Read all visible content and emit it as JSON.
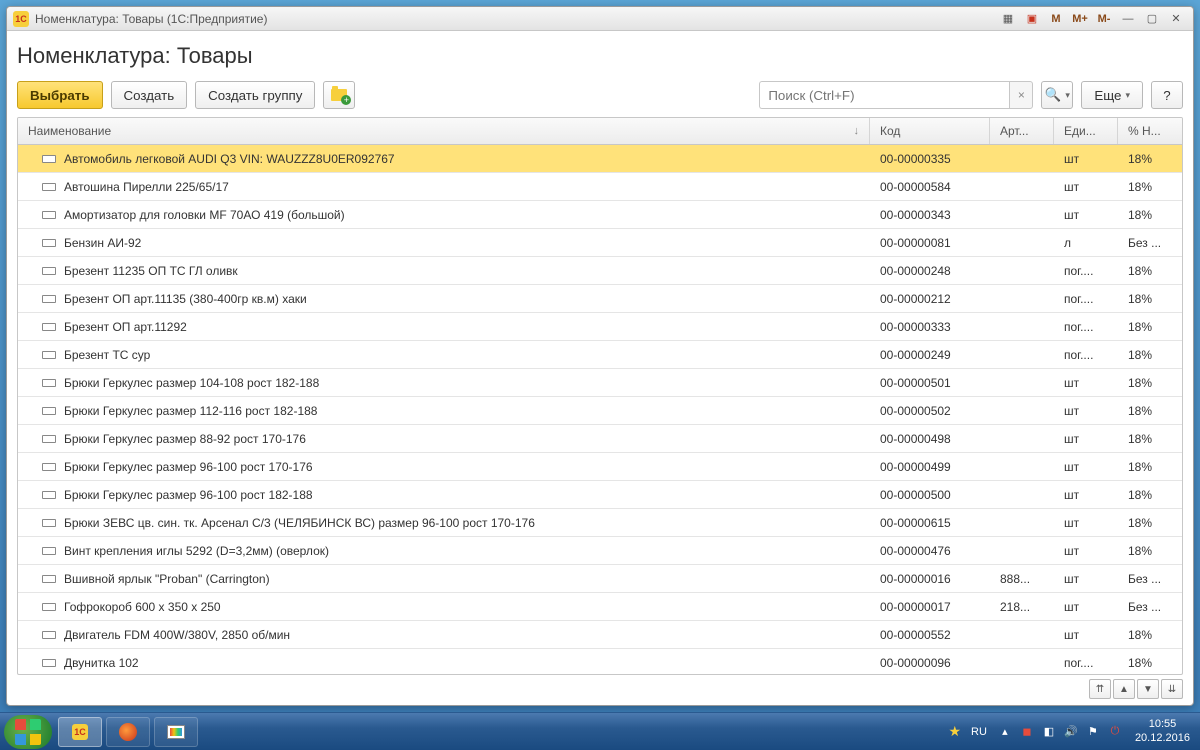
{
  "window": {
    "title": "Номенклатура: Товары (1С:Предприятие)",
    "mem_buttons": [
      "M",
      "M+",
      "M-"
    ]
  },
  "page": {
    "title": "Номенклатура: Товары"
  },
  "toolbar": {
    "select": "Выбрать",
    "create": "Создать",
    "create_group": "Создать группу",
    "more": "Еще",
    "help": "?"
  },
  "search": {
    "placeholder": "Поиск (Ctrl+F)",
    "clear": "×"
  },
  "columns": {
    "name": "Наименование",
    "sort": "↓",
    "code": "Код",
    "art": "Арт...",
    "unit": "Еди...",
    "vat": "% Н..."
  },
  "rows": [
    {
      "name": "Автомобиль легковой AUDI Q3 VIN: WAUZZZ8U0ER092767",
      "code": "00-00000335",
      "art": "",
      "unit": "шт",
      "vat": "18%",
      "sel": true
    },
    {
      "name": "Автошина Пирелли 225/65/17",
      "code": "00-00000584",
      "art": "",
      "unit": "шт",
      "vat": "18%"
    },
    {
      "name": "Амортизатор для головки MF 70АО 419 (большой)",
      "code": "00-00000343",
      "art": "",
      "unit": "шт",
      "vat": "18%"
    },
    {
      "name": "Бензин АИ-92",
      "code": "00-00000081",
      "art": "",
      "unit": "л",
      "vat": "Без ..."
    },
    {
      "name": "Брезент 11235 ОП ТС ГЛ оливк",
      "code": "00-00000248",
      "art": "",
      "unit": "пог....",
      "vat": "18%"
    },
    {
      "name": "Брезент ОП арт.11135 (380-400гр кв.м) хаки",
      "code": "00-00000212",
      "art": "",
      "unit": "пог....",
      "vat": "18%"
    },
    {
      "name": "Брезент ОП арт.11292",
      "code": "00-00000333",
      "art": "",
      "unit": "пог....",
      "vat": "18%"
    },
    {
      "name": "Брезент ТС сур",
      "code": "00-00000249",
      "art": "",
      "unit": "пог....",
      "vat": "18%"
    },
    {
      "name": "Брюки Геркулес размер 104-108 рост 182-188",
      "code": "00-00000501",
      "art": "",
      "unit": "шт",
      "vat": "18%"
    },
    {
      "name": "Брюки Геркулес размер 112-116 рост 182-188",
      "code": "00-00000502",
      "art": "",
      "unit": "шт",
      "vat": "18%"
    },
    {
      "name": "Брюки Геркулес размер 88-92 рост 170-176",
      "code": "00-00000498",
      "art": "",
      "unit": "шт",
      "vat": "18%"
    },
    {
      "name": "Брюки Геркулес размер 96-100 рост 170-176",
      "code": "00-00000499",
      "art": "",
      "unit": "шт",
      "vat": "18%"
    },
    {
      "name": "Брюки Геркулес размер 96-100 рост 182-188",
      "code": "00-00000500",
      "art": "",
      "unit": "шт",
      "vat": "18%"
    },
    {
      "name": "Брюки ЗЕВС цв. син. тк. Арсенал С/3 (ЧЕЛЯБИНСК ВС) размер 96-100 рост 170-176",
      "code": "00-00000615",
      "art": "",
      "unit": "шт",
      "vat": "18%"
    },
    {
      "name": "Винт крепления иглы 5292 (D=3,2мм) (оверлок)",
      "code": "00-00000476",
      "art": "",
      "unit": "шт",
      "vat": "18%"
    },
    {
      "name": "Вшивной ярлык \"Proban\" (Carrington)",
      "code": "00-00000016",
      "art": "888...",
      "unit": "шт",
      "vat": "Без ..."
    },
    {
      "name": "Гофрокороб 600 x 350 x 250",
      "code": "00-00000017",
      "art": "218...",
      "unit": "шт",
      "vat": "Без ..."
    },
    {
      "name": "Двигатель FDM 400W/380V, 2850 об/мин",
      "code": "00-00000552",
      "art": "",
      "unit": "шт",
      "vat": "18%"
    },
    {
      "name": "Двунитка 102",
      "code": "00-00000096",
      "art": "",
      "unit": "пог....",
      "vat": "18%"
    }
  ],
  "nav": {
    "first": "⤒",
    "up": "▲",
    "down": "▼",
    "last": "⤓"
  },
  "taskbar": {
    "lang": "RU",
    "time": "10:55",
    "date": "20.12.2016"
  },
  "app_icon": "1С"
}
